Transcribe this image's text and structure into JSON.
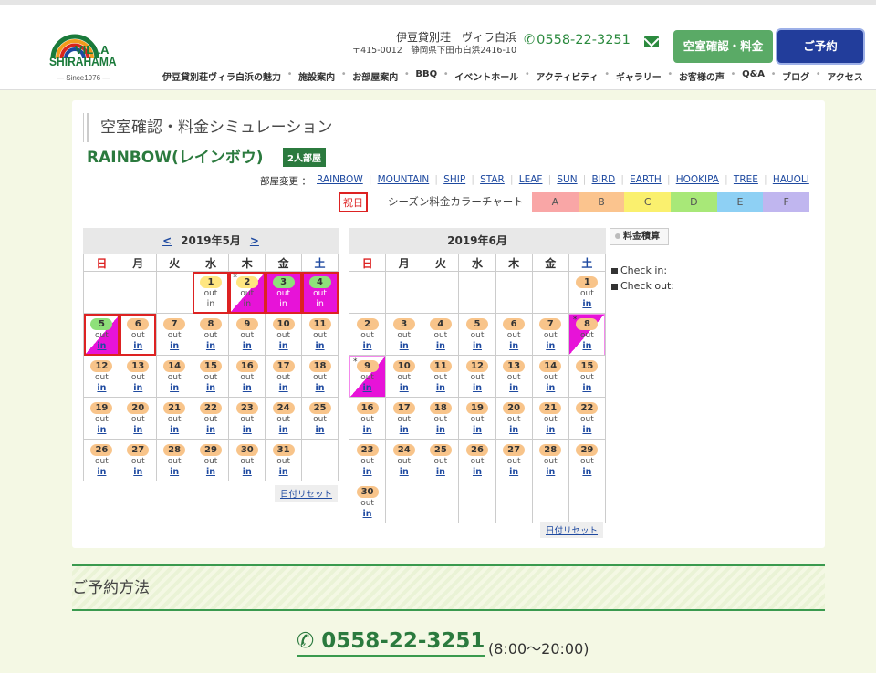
{
  "header": {
    "logo": {
      "line1": "VILLA",
      "line2": "SHIRAHAMA",
      "since": "— Since1976 —"
    },
    "address_name": "伊豆貸別荘　ヴィラ白浜",
    "address_zip": "〒415-0012　静岡県下田市白浜2416-10",
    "tel": "0558-22-3251",
    "availability_button": "空室確認・料金",
    "booking_button": "ご予約",
    "nav": [
      "伊豆貸別荘ヴィラ白浜の魅力",
      "施設案内",
      "お部屋案内",
      "BBQ",
      "イベントホール",
      "アクティビティ",
      "ギャラリー",
      "お客様の声",
      "Q&A",
      "ブログ",
      "アクセス"
    ]
  },
  "simulation": {
    "title": "空室確認・料金シミュレーション",
    "room_name": "RAINBOW(レインボウ)",
    "room_badge": "2人部屋",
    "room_change_label": "部屋変更 ：",
    "rooms": [
      "RAINBOW",
      "MOUNTAIN",
      "SHIP",
      "STAR",
      "LEAF",
      "SUN",
      "BIRD",
      "EARTH",
      "HOOKIPA",
      "TREE",
      "HAUOLI"
    ],
    "holiday_label": "祝日",
    "season_chart_label": "シーズン料金カラーチャート",
    "season_colors": [
      {
        "label": "A",
        "color": "#f9a6a6"
      },
      {
        "label": "B",
        "color": "#fbc48e"
      },
      {
        "label": "C",
        "color": "#faf06e"
      },
      {
        "label": "D",
        "color": "#a8e878"
      },
      {
        "label": "E",
        "color": "#8ed0f4"
      },
      {
        "label": "F",
        "color": "#c0b6ef"
      }
    ],
    "weekdays": [
      "日",
      "月",
      "火",
      "水",
      "木",
      "金",
      "土"
    ],
    "prev": "<",
    "next": ">",
    "reset_label": "日付リセット",
    "calc_label": "料金積算",
    "checkin_label": "Check in:",
    "checkout_label": "Check out:",
    "out_label": "out",
    "in_label": "in",
    "may": {
      "title": "2019年5月",
      "start": 3,
      "days": 31,
      "cells": {
        "1": {
          "pill": "y",
          "sel": true,
          "inplain": true
        },
        "2": {
          "pill": "y",
          "star": true,
          "half": true,
          "sel": true,
          "inplain": true
        },
        "3": {
          "pill": "g",
          "bk": true,
          "sel": true,
          "inplain": true
        },
        "4": {
          "pill": "g",
          "bk": true,
          "sel": true,
          "inplain": true
        },
        "5": {
          "pill": "g",
          "half": true,
          "sel": true
        },
        "6": {
          "sel": true
        }
      }
    },
    "june": {
      "title": "2019年6月",
      "start": 6,
      "days": 30,
      "cells": {
        "8": {
          "star": true,
          "halfr": true
        },
        "9": {
          "star": true,
          "halfl": true
        }
      }
    }
  },
  "reservation": {
    "title": "ご予約方法",
    "tel": "0558-22-3251",
    "hours": "(8:00～20:00)"
  }
}
